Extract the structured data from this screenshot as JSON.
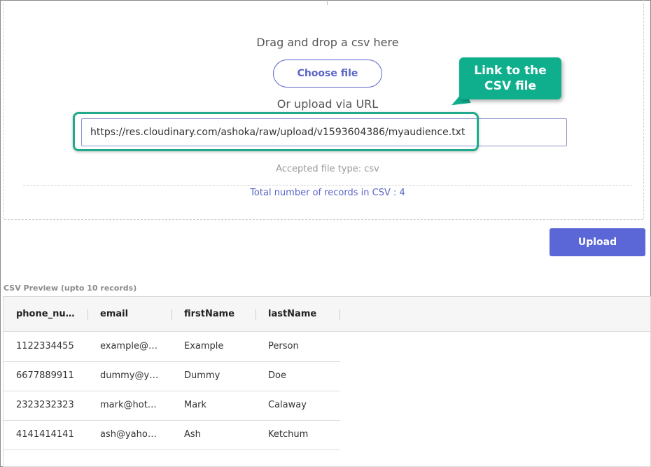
{
  "upload": {
    "drag_text": "Drag and drop a csv here",
    "choose_file_label": "Choose file",
    "or_url_text": "Or upload via URL",
    "url_value": "https://res.cloudinary.com/ashoka/raw/upload/v1593604386/myaudience.txt",
    "accepted_text": "Accepted file type: csv",
    "total_records_text": "Total number of records in CSV : 4"
  },
  "callout": {
    "line1": "Link to the",
    "line2": "CSV file"
  },
  "actions": {
    "upload_label": "Upload"
  },
  "preview": {
    "label": "CSV Preview (upto 10 records)",
    "columns": [
      "phone_number",
      "email",
      "firstName",
      "lastName"
    ],
    "rows": [
      [
        "1122334455",
        "example@gmail.com",
        "Example",
        "Person"
      ],
      [
        "6677889911",
        "dummy@yahoo.com",
        "Dummy",
        "Doe"
      ],
      [
        "2323232323",
        "mark@hotmail.com",
        "Mark",
        "Calaway"
      ],
      [
        "4141414141",
        "ash@yahoo.com",
        "Ash",
        "Ketchum"
      ]
    ]
  },
  "colors": {
    "accent": "#5b67d6",
    "callout": "#0faf8e"
  }
}
